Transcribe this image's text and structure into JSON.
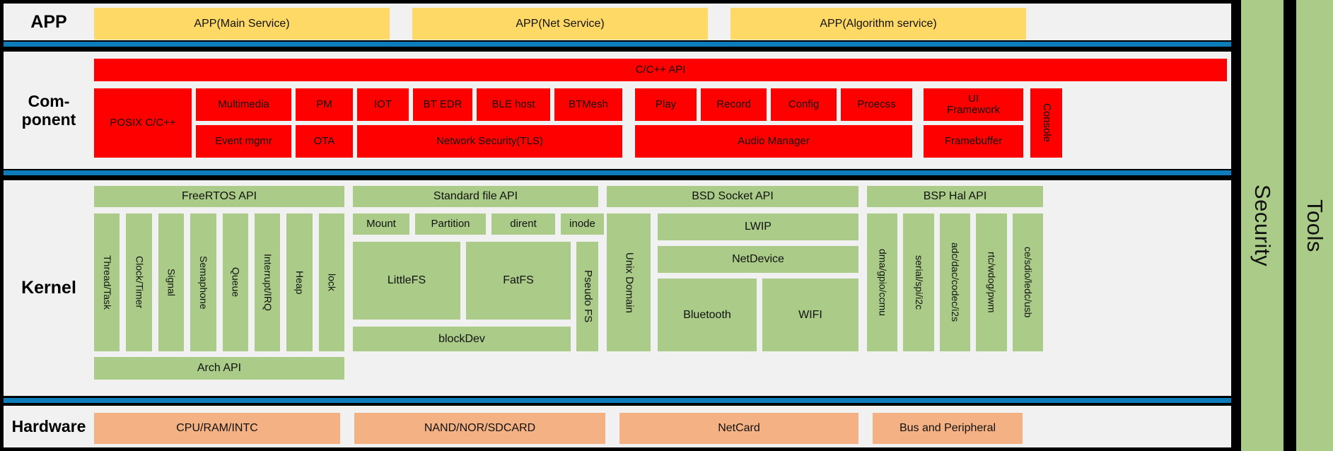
{
  "rails": {
    "security": "Security",
    "tools": "Tools"
  },
  "layers": {
    "app": {
      "label": "APP",
      "items": [
        "APP(Main Service)",
        "APP(Net Service)",
        "APP(Algorithm service)"
      ]
    },
    "component": {
      "label_line1": "Com-",
      "label_line2": "ponent",
      "api_bar": "C/C++ API",
      "posix": "POSIX C/C++",
      "multimedia": "Multimedia",
      "event_mgmr": "Event mgmr",
      "pm": "PM",
      "ota": "OTA",
      "iot": "IOT",
      "bt_edr": "BT EDR",
      "ble_host": "BLE host",
      "btmesh": "BTMesh",
      "network_security": "Network Security(TLS)",
      "play": "Play",
      "record": "Record",
      "config": "Config",
      "process": "Proecss",
      "audio_manager": "Audio Manager",
      "ui_framework": "UI\nFramework",
      "framebuffer": "Framebuffer",
      "console": "Console"
    },
    "kernel": {
      "label": "Kernel",
      "freertos": {
        "api": "FreeRTOS API",
        "slots": [
          "Thread/Task",
          "Clock/Timer",
          "Signal",
          "Semaphone",
          "Queue",
          "Interrupt/IRQ",
          "Heap",
          "lock"
        ],
        "arch_api": "Arch API"
      },
      "filesystem": {
        "api": "Standard file API",
        "row1": [
          "Mount",
          "Partition",
          "dirent",
          "inode"
        ],
        "littlefs": "LittleFS",
        "fatfs": "FatFS",
        "pseudo_fs": "Pseudo FS",
        "blockdev": "blockDev"
      },
      "network": {
        "api": "BSD Socket API",
        "unix_domain": "Unix Domain",
        "lwip": "LWIP",
        "netdevice": "NetDevice",
        "bluetooth": "Bluetooth",
        "wifi": "WIFI"
      },
      "bsp": {
        "api": "BSP Hal API",
        "slots": [
          "dma/gpio/ccmu",
          "serial/spi/i2c",
          "adc/dac/codec/i2s",
          "rtc/wdog/pwm",
          "ce/sdio/ledc/usb"
        ]
      }
    },
    "hardware": {
      "label": "Hardware",
      "items": [
        "CPU/RAM/INTC",
        "NAND/NOR/SDCARD",
        "NetCard",
        "Bus and Peripheral"
      ]
    }
  },
  "colors": {
    "app_box": "#ffd966",
    "component_box": "#fe0000",
    "kernel_box": "#aacc88",
    "hardware_box": "#f4b183",
    "divider_blue": "#0c7cba",
    "divider_black": "#000000",
    "band_background": "#f1f1f1"
  }
}
